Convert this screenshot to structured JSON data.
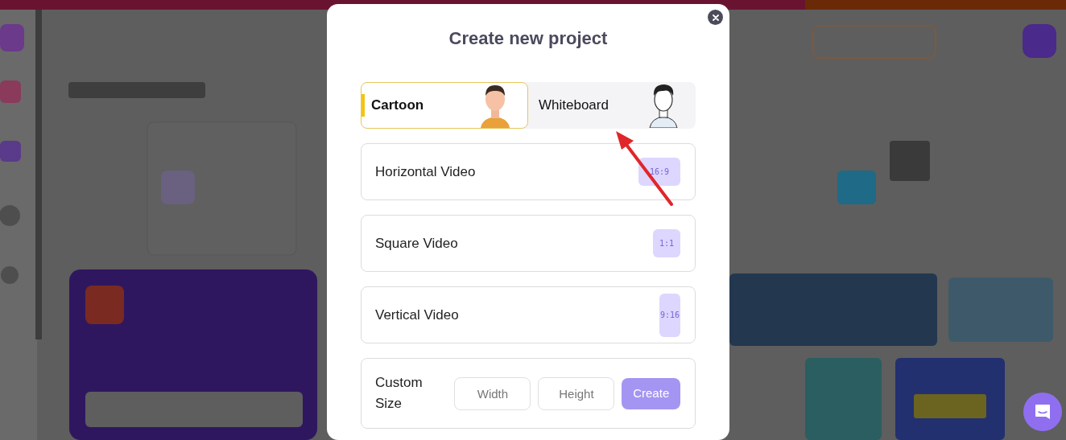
{
  "modal": {
    "title": "Create new project",
    "style_tabs": [
      {
        "label": "Cartoon",
        "selected": true,
        "kind": "cartoon"
      },
      {
        "label": "Whiteboard",
        "selected": false,
        "kind": "sketch"
      }
    ],
    "formats": [
      {
        "label": "Horizontal Video",
        "ratio": "16:9",
        "kind": "wide"
      },
      {
        "label": "Square Video",
        "ratio": "1:1",
        "kind": "square"
      },
      {
        "label": "Vertical Video",
        "ratio": "9:16",
        "kind": "tall"
      }
    ],
    "custom_size": {
      "label": "Custom Size",
      "width": {
        "placeholder": "Width"
      },
      "height": {
        "placeholder": "Height"
      },
      "create": {
        "label": "Create",
        "disabled": true
      }
    }
  }
}
